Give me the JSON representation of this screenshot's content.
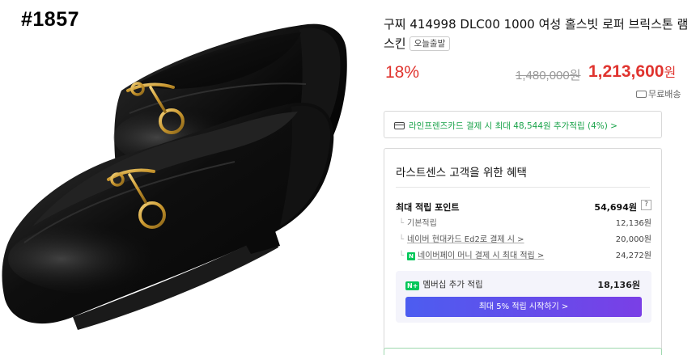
{
  "image": {
    "product_id": "#1857"
  },
  "product": {
    "title": "구찌 414998 DLC00 1000 여성 홀스빗 로퍼 브릭스톤 램스킨",
    "badge": "오늘출발",
    "discount": "18%",
    "original_price": "1,480,000원",
    "sale_price": "1,213,600",
    "sale_unit": "원",
    "shipping": "무료배송"
  },
  "card_benefit": {
    "text": "라인프렌즈카드 결제 시 최대 48,544원 추가적립 (4%) >"
  },
  "benefits": {
    "title": "라스트센스 고객을 위한 혜택",
    "max_points_label": "최대 적립 포인트",
    "max_points_value": "54,694원",
    "help": "?",
    "rows": [
      {
        "label": "기본적립",
        "value": "12,136원"
      },
      {
        "label": "네이버 현대카드 Ed2로 결제 시 >",
        "value": "20,000원"
      },
      {
        "label": "네이버페이 머니 결제 시 최대 적립 >",
        "value": "24,272원"
      }
    ],
    "membership_label": "멤버십 추가 적립",
    "membership_badge": "N+",
    "npay_badge": "N",
    "membership_value": "18,136원",
    "membership_button": "최대 5% 적립 시작하기 >"
  },
  "colors": {
    "accent_red": "#e0342f",
    "card_green": "#1aa34a",
    "naver_green": "#03c75a",
    "button_gradient_start": "#4c5df0",
    "button_gradient_end": "#7a3fe6"
  }
}
